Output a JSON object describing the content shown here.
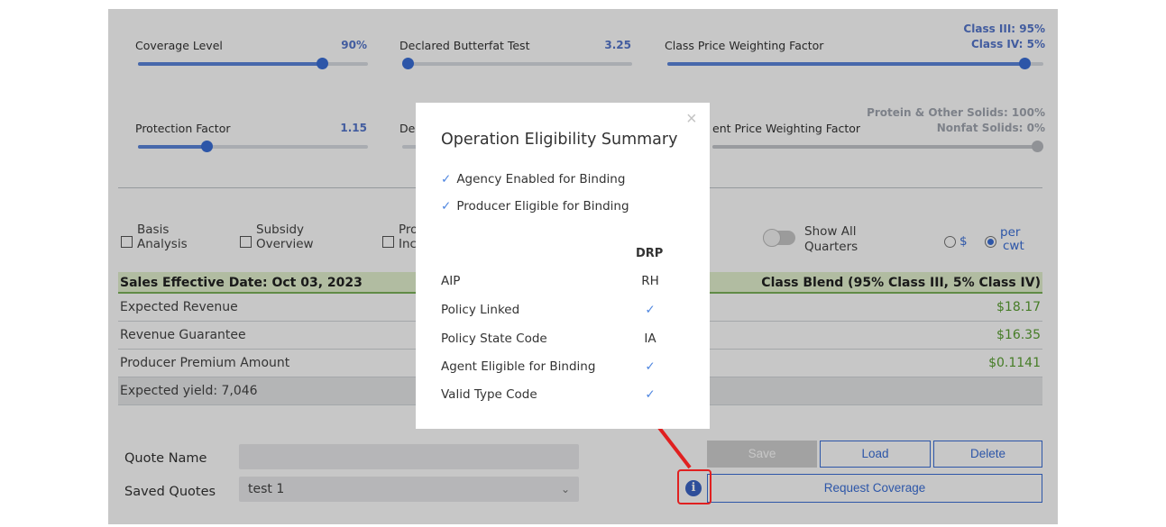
{
  "sliders": [
    {
      "id": "coverage",
      "label": "Coverage Level",
      "value": "90%",
      "level": 0.8
    },
    {
      "id": "butterfat",
      "label": "Declared Butterfat Test",
      "value": "3.25",
      "level": 0.0
    },
    {
      "id": "class_weight",
      "label": "Class Price Weighting Factor",
      "value_line1": "Class III: 95%",
      "value_line2": "Class IV: 5%",
      "level": 0.95
    },
    {
      "id": "protection",
      "label": "Protection Factor",
      "value": "1.15",
      "level": 0.3
    },
    {
      "id": "declared_hidden",
      "label": "De",
      "level": 0.0
    },
    {
      "id": "component_weight",
      "label": "ent Price Weighting Factor",
      "value_line1": "Protein & Other Solids: 100%",
      "value_line2": "Nonfat Solids: 0%",
      "level": 1.0
    }
  ],
  "options": {
    "basis_line1": "Basis",
    "basis_line2": "Analysis",
    "subsidy_line1": "Subsidy",
    "subsidy_line2": "Overview",
    "pro_line1": "Pro",
    "pro_line2": "Inc",
    "show_all_line1": "Show All",
    "show_all_line2": "Quarters",
    "radio_dollar": "$",
    "radio_cwt_line1": "per",
    "radio_cwt_line2": "cwt"
  },
  "table": {
    "header_left": "Sales Effective Date: Oct 03, 2023",
    "header_right": "Class Blend (95% Class III, 5% Class IV)",
    "rows": [
      {
        "label": "Expected Revenue",
        "value": "$18.17"
      },
      {
        "label": "Revenue Guarantee",
        "value": "$16.35"
      },
      {
        "label": "Producer Premium Amount",
        "value": "$0.1141"
      }
    ],
    "yield_text": "Expected yield: 7,046"
  },
  "quote": {
    "name_label": "Quote Name",
    "name_value": "",
    "saved_label": "Saved Quotes",
    "saved_value": "test 1"
  },
  "buttons": {
    "save": "Save",
    "load": "Load",
    "delete": "Delete",
    "request": "Request Coverage"
  },
  "modal": {
    "title": "Operation Eligibility Summary",
    "close": "×",
    "checks": [
      "Agency Enabled for Binding",
      "Producer Eligible for Binding"
    ],
    "column_header": "DRP",
    "rows": [
      {
        "label": "AIP",
        "value": "RH"
      },
      {
        "label": "Policy Linked",
        "value": "✓"
      },
      {
        "label": "Policy State Code",
        "value": "IA"
      },
      {
        "label": "Agent Eligible for Binding",
        "value": "✓"
      },
      {
        "label": "Valid Type Code",
        "value": "✓"
      }
    ]
  },
  "colors": {
    "accent": "#3a6fd8",
    "positive": "#5aa032",
    "annotation": "#e02020"
  },
  "icons": {
    "info": "info-circle-icon",
    "check": "check-icon",
    "close": "close-icon",
    "caret": "chevron-down-icon"
  }
}
